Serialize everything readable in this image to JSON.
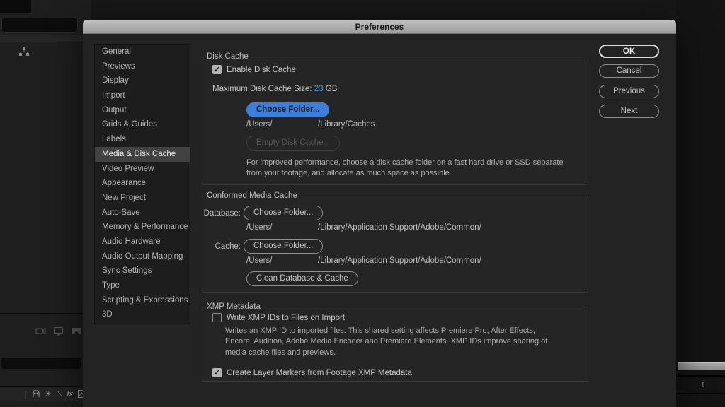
{
  "window": {
    "title": "Preferences"
  },
  "sidebar": {
    "items": [
      {
        "label": "General",
        "selected": false
      },
      {
        "label": "Previews",
        "selected": false
      },
      {
        "label": "Display",
        "selected": false
      },
      {
        "label": "Import",
        "selected": false
      },
      {
        "label": "Output",
        "selected": false
      },
      {
        "label": "Grids & Guides",
        "selected": false
      },
      {
        "label": "Labels",
        "selected": false
      },
      {
        "label": "Media & Disk Cache",
        "selected": true
      },
      {
        "label": "Video Preview",
        "selected": false
      },
      {
        "label": "Appearance",
        "selected": false
      },
      {
        "label": "New Project",
        "selected": false
      },
      {
        "label": "Auto-Save",
        "selected": false
      },
      {
        "label": "Memory & Performance",
        "selected": false
      },
      {
        "label": "Audio Hardware",
        "selected": false
      },
      {
        "label": "Audio Output Mapping",
        "selected": false
      },
      {
        "label": "Sync Settings",
        "selected": false
      },
      {
        "label": "Type",
        "selected": false
      },
      {
        "label": "Scripting & Expressions",
        "selected": false
      },
      {
        "label": "3D",
        "selected": false
      }
    ]
  },
  "disk_cache": {
    "title": "Disk Cache",
    "enable_label": "Enable Disk Cache",
    "enable_checked": true,
    "max_size_label": "Maximum Disk Cache Size:",
    "max_size_value": "23",
    "max_size_unit": "GB",
    "choose_folder_label": "Choose Folder...",
    "path_prefix": "/Users/",
    "path_suffix": "/Library/Caches",
    "empty_button_label": "Empty Disk Cache...",
    "description": "For improved performance, choose a disk cache folder on a fast hard drive or SSD separate from your footage, and allocate as much space as possible."
  },
  "conformed_cache": {
    "title": "Conformed Media Cache",
    "database_label": "Database:",
    "database_choose_label": "Choose Folder...",
    "database_path_prefix": "/Users/",
    "database_path_suffix": "/Library/Application Support/Adobe/Common/",
    "cache_label": "Cache:",
    "cache_choose_label": "Choose Folder...",
    "cache_path_prefix": "/Users/",
    "cache_path_suffix": "/Library/Application Support/Adobe/Common/",
    "clean_button_label": "Clean Database & Cache"
  },
  "xmp": {
    "title": "XMP Metadata",
    "write_label": "Write XMP IDs to Files on Import",
    "write_checked": false,
    "description": "Writes an XMP ID to imported files. This shared setting affects Premiere Pro, After Effects, Encore, Audition, Adobe Media Encoder and Premiere Elements. XMP IDs improve sharing of media cache files and previews.",
    "markers_label": "Create Layer Markers from Footage XMP Metadata",
    "markers_checked": true
  },
  "actions": {
    "ok": "OK",
    "cancel": "Cancel",
    "previous": "Previous",
    "next": "Next"
  },
  "background": {
    "timeline_item_number": "1",
    "fx_icon_label": "fx"
  },
  "colors": {
    "accent_blue": "#3d7edb",
    "hot_text_blue": "#4da0e8",
    "dialog_bg": "#232323",
    "titlebar_gray": "#b0b0b0"
  }
}
